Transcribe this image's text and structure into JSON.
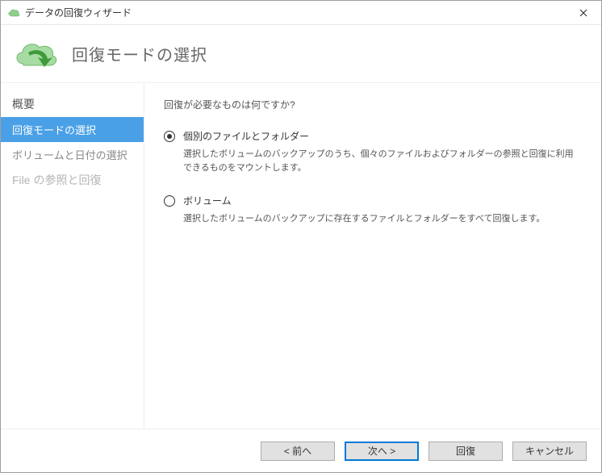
{
  "window": {
    "title": "データの回復ウィザード"
  },
  "header": {
    "title": "回復モードの選択"
  },
  "sidebar": {
    "items": [
      {
        "label": "概要",
        "state": "done"
      },
      {
        "label": "回復モードの選択",
        "state": "active"
      },
      {
        "label": "ボリュームと日付の選択",
        "state": "pending"
      },
      {
        "label": "File の参照と回復",
        "state": "future"
      }
    ]
  },
  "content": {
    "question": "回復が必要なものは何ですか?",
    "options": [
      {
        "id": "option-individual",
        "label": "個別のファイルとフォルダー",
        "desc": "選択したボリュームのバックアップのうち、個々のファイルおよびフォルダーの参照と回復に利用できるものをマウントします。",
        "checked": true
      },
      {
        "id": "option-volume",
        "label": "ボリューム",
        "desc": "選択したボリュームのバックアップに存在するファイルとフォルダーをすべて回復します。",
        "checked": false
      }
    ]
  },
  "footer": {
    "back": "<  前へ",
    "next": "次へ  >",
    "recover": "回復",
    "cancel": "キャンセル"
  }
}
